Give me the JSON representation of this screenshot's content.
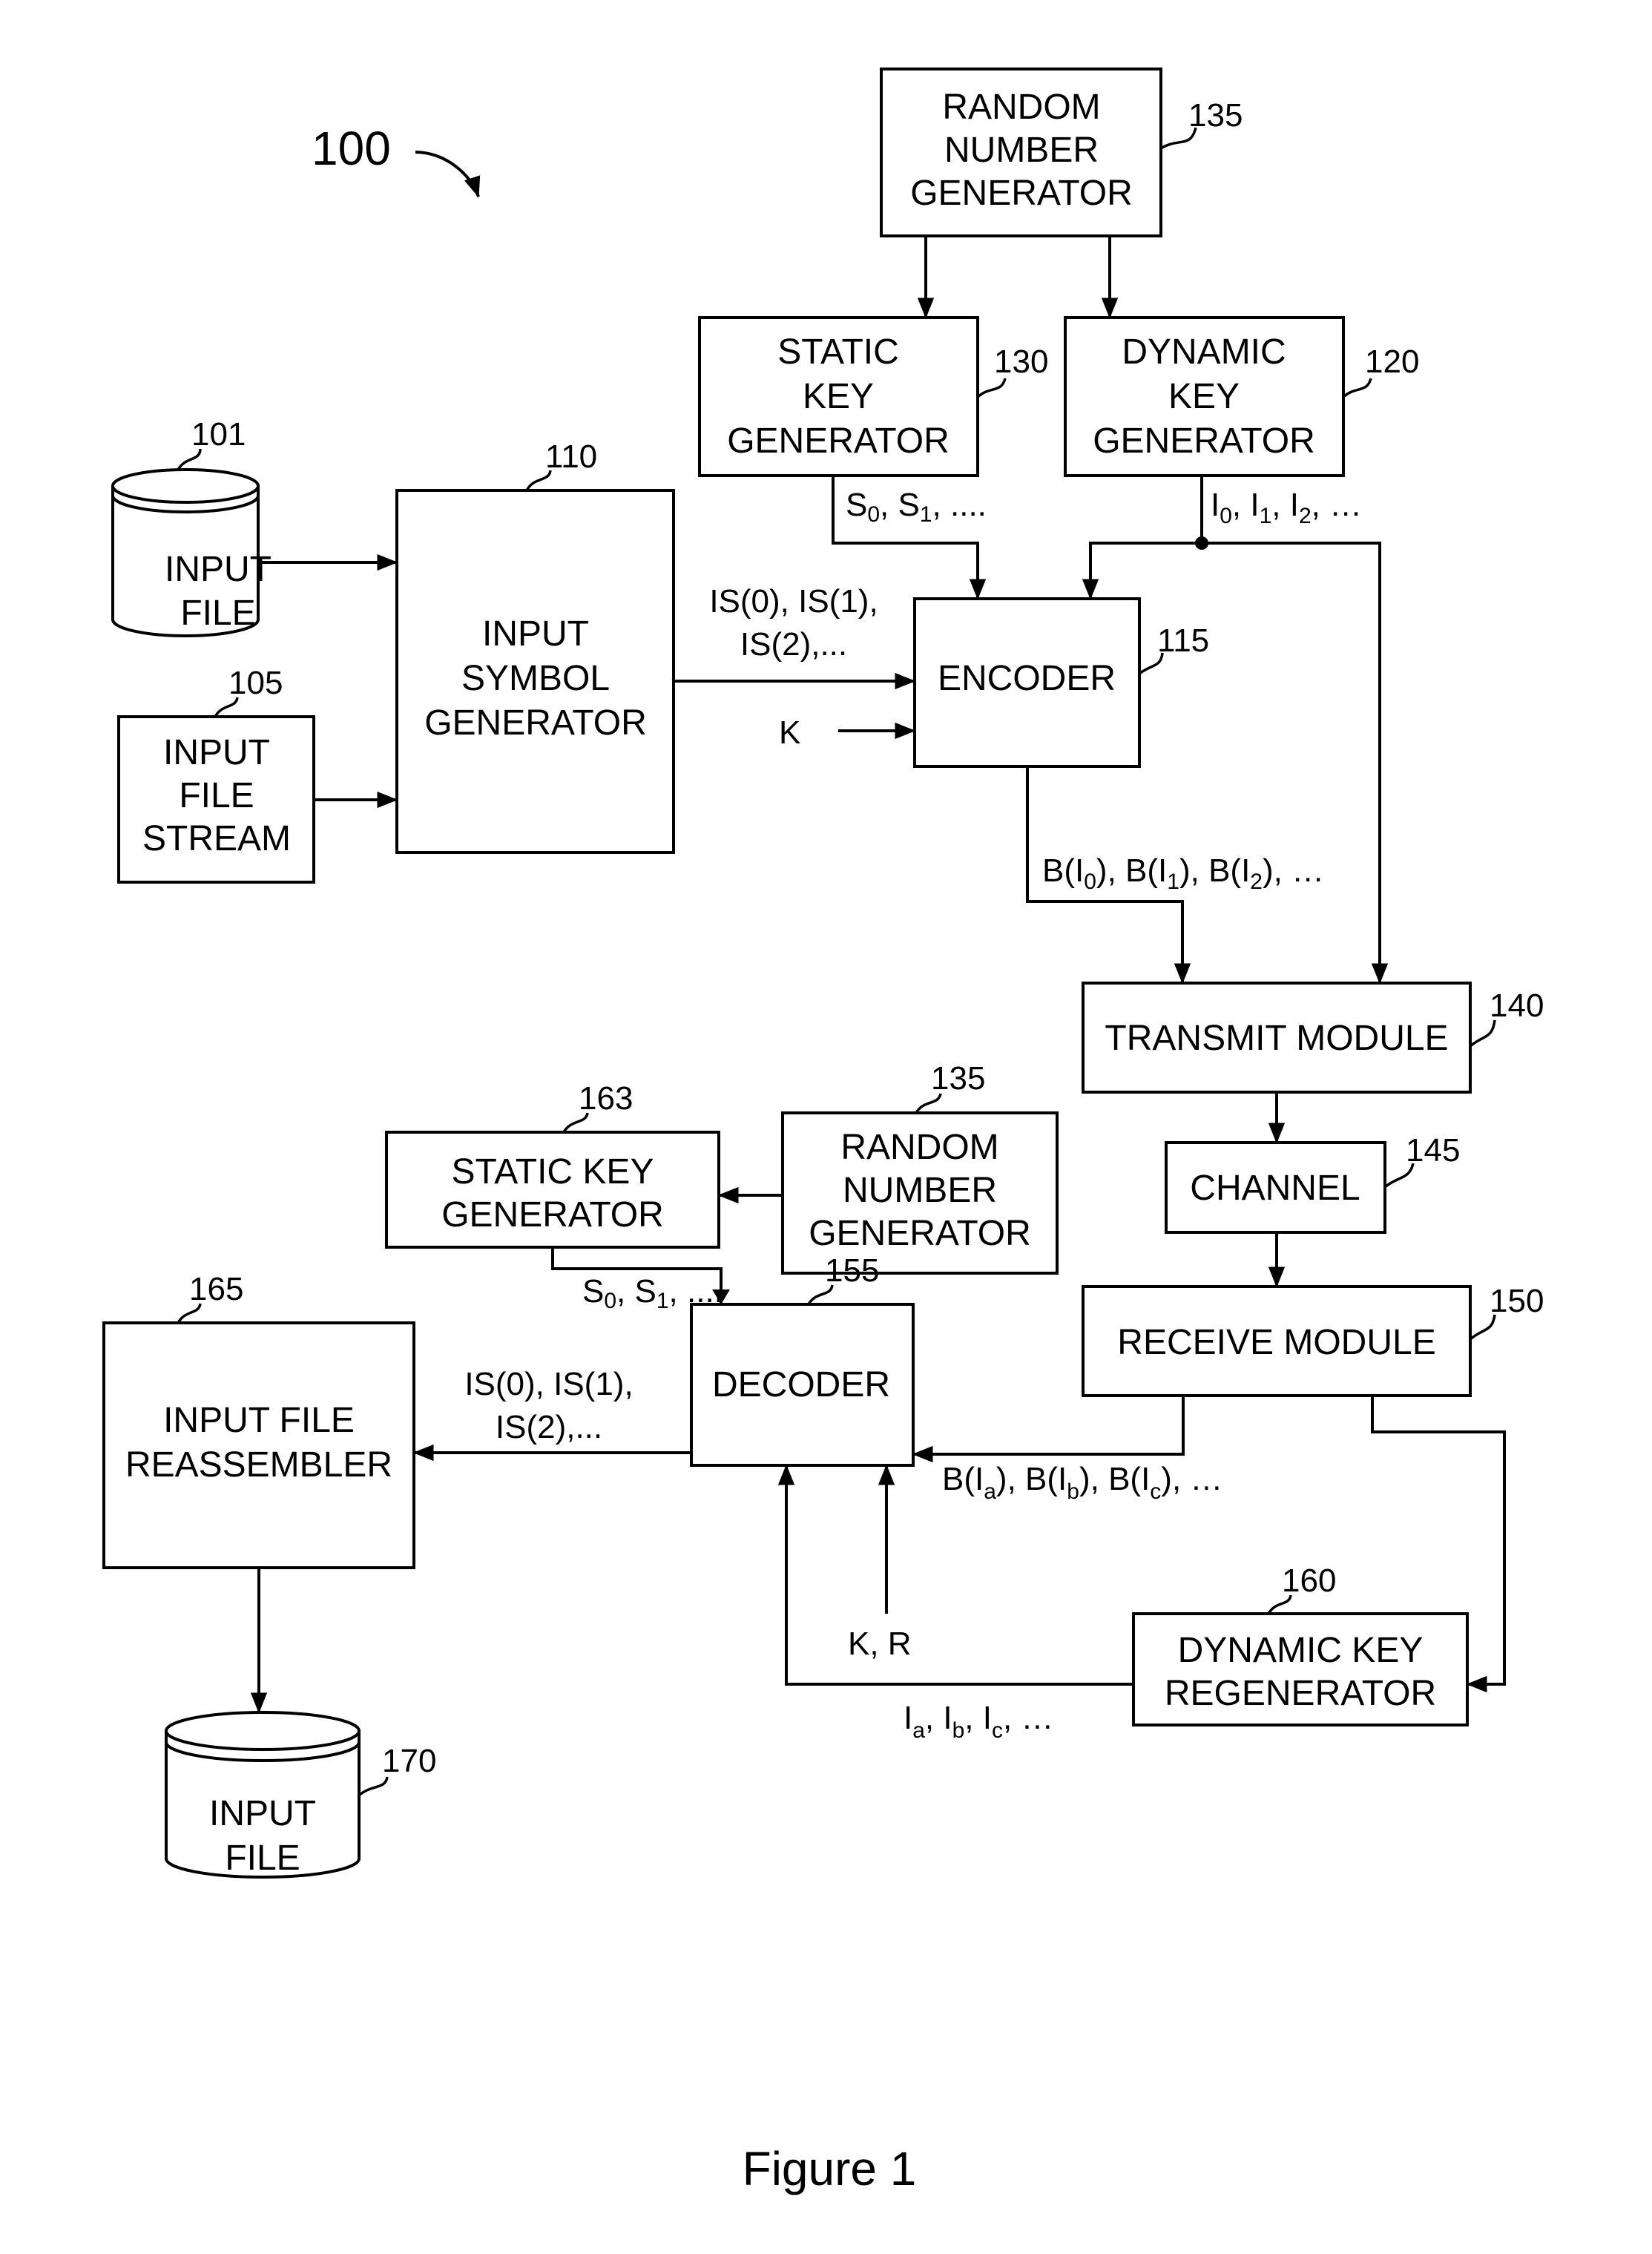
{
  "figure": {
    "title": "Figure 1",
    "system_ref": "100"
  },
  "blocks": {
    "rng_top": {
      "lines": [
        "RANDOM",
        "NUMBER",
        "GENERATOR"
      ],
      "ref": "135"
    },
    "static_key_gen": {
      "lines": [
        "STATIC",
        "KEY",
        "GENERATOR"
      ],
      "ref": "130"
    },
    "dynamic_key_gen": {
      "lines": [
        "DYNAMIC",
        "KEY",
        "GENERATOR"
      ],
      "ref": "120"
    },
    "input_file_top": {
      "lines": [
        "INPUT",
        "FILE"
      ],
      "ref": "101"
    },
    "input_file_stream": {
      "lines": [
        "INPUT",
        "FILE",
        "STREAM"
      ],
      "ref": "105"
    },
    "input_symbol_gen": {
      "lines": [
        "INPUT",
        "SYMBOL",
        "GENERATOR"
      ],
      "ref": "110"
    },
    "encoder": {
      "lines": [
        "ENCODER"
      ],
      "ref": "115"
    },
    "transmit_module": {
      "lines": [
        "TRANSMIT MODULE"
      ],
      "ref": "140"
    },
    "channel": {
      "lines": [
        "CHANNEL"
      ],
      "ref": "145"
    },
    "receive_module": {
      "lines": [
        "RECEIVE MODULE"
      ],
      "ref": "150"
    },
    "rng_bottom": {
      "lines": [
        "RANDOM",
        "NUMBER",
        "GENERATOR"
      ],
      "ref": "135"
    },
    "static_key_gen_rx": {
      "lines": [
        "STATIC KEY",
        "GENERATOR"
      ],
      "ref": "163"
    },
    "decoder": {
      "lines": [
        "DECODER"
      ],
      "ref": "155"
    },
    "reassembler": {
      "lines": [
        "INPUT FILE",
        "REASSEMBLER"
      ],
      "ref": "165"
    },
    "dynamic_key_regen": {
      "lines": [
        "DYNAMIC KEY",
        "REGENERATOR"
      ],
      "ref": "160"
    },
    "input_file_out": {
      "lines": [
        "INPUT",
        "FILE"
      ],
      "ref": "170"
    }
  },
  "signals": {
    "static_keys_tx": {
      "parts": [
        [
          "S",
          "0"
        ],
        [
          "S",
          "1"
        ]
      ],
      "tail": ", ...."
    },
    "dynamic_keys_tx": {
      "parts": [
        [
          "I",
          "0"
        ],
        [
          "I",
          "1"
        ],
        [
          "I",
          "2"
        ]
      ],
      "tail": ", …"
    },
    "input_symbols_tx": {
      "line1": "IS(0), IS(1),",
      "line2": "IS(2),..."
    },
    "k_input": "K",
    "encoded_tx": {
      "parts": [
        [
          "B(I",
          "0",
          ")"
        ],
        [
          "B(I",
          "1",
          ")"
        ],
        [
          "B(I",
          "2",
          ")"
        ]
      ],
      "tail": ", …"
    },
    "static_keys_rx": {
      "parts": [
        [
          "S",
          "0"
        ],
        [
          "S",
          "1"
        ]
      ],
      "tail": ", ...."
    },
    "input_symbols_rx": {
      "line1": "IS(0), IS(1),",
      "line2": "IS(2),..."
    },
    "encoded_rx": {
      "parts": [
        [
          "B(I",
          "a",
          ")"
        ],
        [
          "B(I",
          "b",
          ")"
        ],
        [
          "B(I",
          "c",
          ")"
        ]
      ],
      "tail": ", …"
    },
    "kr_input": "K, R",
    "dynamic_keys_rx": {
      "parts": [
        [
          "I",
          "a"
        ],
        [
          "I",
          "b"
        ],
        [
          "I",
          "c"
        ]
      ],
      "tail": ", …"
    }
  }
}
